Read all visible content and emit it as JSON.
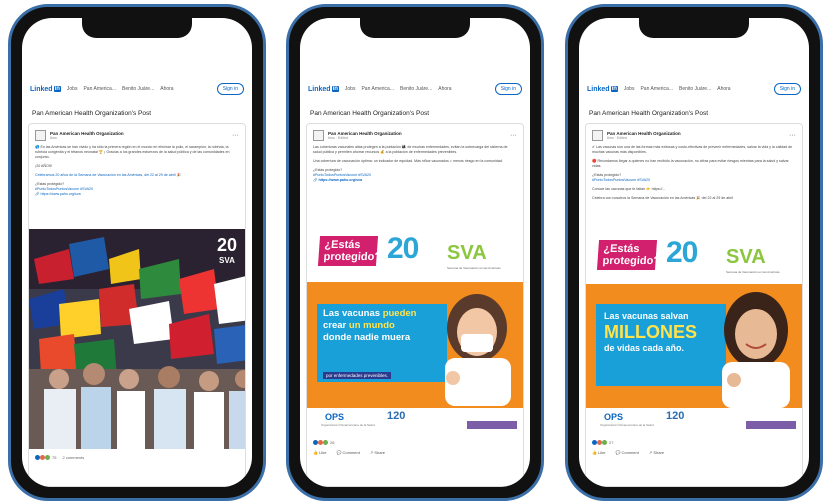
{
  "phones": [
    {
      "linkedin_logo": "Linked",
      "linkedin_logo_in": "in",
      "nav": [
        "Jobs",
        "Pan America...",
        "Benito Juáre...",
        "Ahora"
      ],
      "sign_in": "Sign in",
      "post_title": "Pan American Health Organization's Post",
      "author": "Pan American Health Organization",
      "author_sub": "6mo",
      "text_lines": [
        "🌎 En las Américas se han vivido y ha sido la primera región en el mundo en eliminar la polio, el sarampión, la rubéola, la rubéola congénita y el tétanos neonatal 🏆 ¡ Gracias a los grandes esfuerzos de la salud pública y de las comunidades en conjunto.",
        "¡20 AÑOS!",
        "Celebramos 20 años de la Semana de Vacunación en las Américas, del 22 al 29 de abril 🎉"
      ],
      "links": [
        "¿Estás protegido?",
        "#PuntoTodosPuntosVacune #SVA20",
        "🔗 https://www.paho.org/sva"
      ],
      "badge": "20",
      "badge_sub": "SVA",
      "reaction_count": "75",
      "reaction_extra": "2 comments"
    },
    {
      "linkedin_logo": "Linked",
      "linkedin_logo_in": "in",
      "nav": [
        "Jobs",
        "Pan America...",
        "Benito Juáre...",
        "Ahora"
      ],
      "sign_in": "Sign in",
      "post_title": "Pan American Health Organization's Post",
      "author": "Pan American Health Organization",
      "author_sub": "6mo · Edited",
      "text_lines": [
        "Las coberturas vacunales altas protegen a la población 👨‍👩‍👧 de muchas enfermedades, evitan la sobrecarga del sistema de salud pública y permiten ahorrar recursos 💰 a la población de enfermedades prevenibles.",
        "Una cobertura de vacunación óptima: un indicador de equidad. Más niños vacunados = menos riesgo en la comunidad."
      ],
      "links": [
        "¿Estás protegido?",
        "#PuntoTodosPuntosVacune #SVA20",
        "🔗 https://www.paho.org/sva"
      ],
      "poster_question": "¿Estás protegido?",
      "poster_20": "20",
      "poster_sva": "SVA",
      "poster_sva_sub": "Semana de Vacunación en las Américas",
      "poster_msg": [
        "Las vacunas",
        "pueden",
        "crear",
        "un mundo",
        "donde nadie muera"
      ],
      "poster_msg_sub": "por enfermedades prevenibles.",
      "ops": "OPS",
      "ops_sub": "Organización Panamericana de la Salud",
      "n120": "120",
      "reactions": "26",
      "actions": [
        "Like",
        "Comment",
        "Share"
      ]
    },
    {
      "linkedin_logo": "Linked",
      "linkedin_logo_in": "in",
      "nav": [
        "Jobs",
        "Pan America...",
        "Benito Juáre...",
        "Ahora"
      ],
      "sign_in": "Sign in",
      "post_title": "Pan American Health Organization's Post",
      "author": "Pan American Health Organization",
      "author_sub": "6mo · Edited",
      "text_lines": [
        "✔ Las vacunas son una de las formas más exitosas y costo-efectivas de prevenir enfermedades, salvar la vida y la calidad de muchas vacunas más disponibles.",
        "🔴 Recordamos llegar a quienes no han recibido la vacunación, no cifras para evitar riesgos mientras para la salud y salvar vidas.",
        "Conoce las vacunas que te faltan 👉 https://...",
        "Celebra con nosotros la Semana de Vacunación en las Américas 🎉 del 22 al 29 de abril"
      ],
      "links": [
        "¿Estás protegido?",
        "#PuntoTodosPuntosVacune #SVA20"
      ],
      "poster_question": "¿Estás protegido?",
      "poster_20": "20",
      "poster_sva": "SVA",
      "poster_sva_sub": "Semana de Vacunación en las Américas",
      "poster_msg": [
        "Las vacunas salvan",
        "MILLONES",
        "de vidas cada año."
      ],
      "ops": "OPS",
      "ops_sub": "Organización Panamericana de la Salud",
      "n120": "120",
      "reactions": "27",
      "actions": [
        "Like",
        "Comment",
        "Share"
      ]
    }
  ],
  "colors": {
    "linkedin_blue": "#0a66c2",
    "magenta": "#d21f6e",
    "sva_blue": "#2ba6d6",
    "sva_green": "#8cc63f",
    "orange": "#f28c1e",
    "navy": "#2b3a8c"
  }
}
